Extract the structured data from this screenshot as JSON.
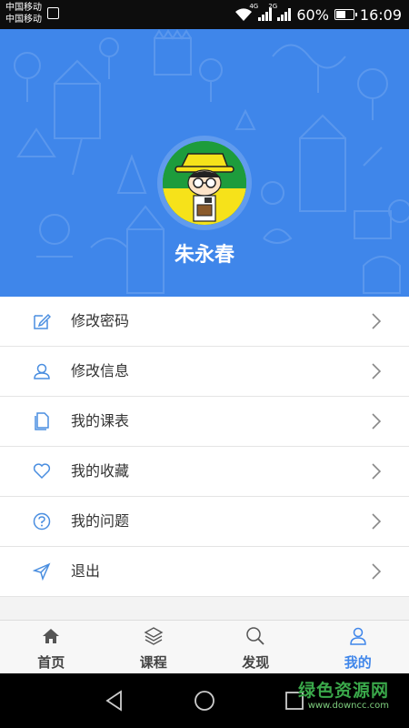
{
  "status_bar": {
    "carrier1": "中国移动",
    "carrier2": "中国移动",
    "net1": "4G",
    "net2": "2G",
    "battery": "60%",
    "battery_level": 0.6,
    "time": "16:09"
  },
  "profile": {
    "name": "朱永春"
  },
  "menu": {
    "items": [
      {
        "label": "修改密码",
        "icon": "edit-icon"
      },
      {
        "label": "修改信息",
        "icon": "user-icon"
      },
      {
        "label": "我的课表",
        "icon": "document-icon"
      },
      {
        "label": "我的收藏",
        "icon": "heart-icon"
      },
      {
        "label": "我的问题",
        "icon": "question-icon"
      },
      {
        "label": "退出",
        "icon": "send-icon"
      }
    ]
  },
  "tabs": [
    {
      "label": "首页",
      "icon": "home-icon",
      "active": false
    },
    {
      "label": "课程",
      "icon": "layers-icon",
      "active": false
    },
    {
      "label": "发现",
      "icon": "search-icon",
      "active": false
    },
    {
      "label": "我的",
      "icon": "user-icon",
      "active": true
    }
  ],
  "watermark": {
    "text": "绿色资源网",
    "url": "www.downcc.com"
  },
  "colors": {
    "header_blue": "#3f86ea",
    "icon_blue": "#4a8ee0",
    "active_tab": "#3f86ea"
  }
}
